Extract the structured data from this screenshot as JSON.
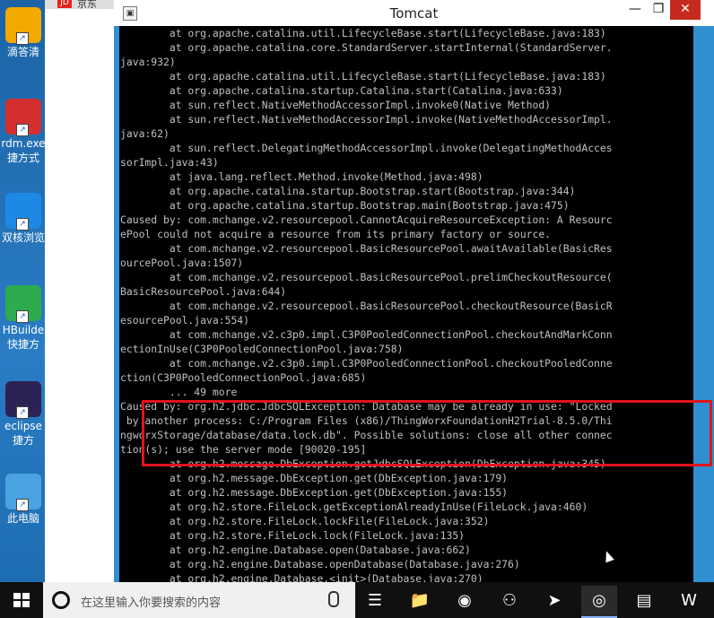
{
  "window": {
    "title": "Tomcat",
    "app_icon_glyph": "▣",
    "minimize": "—",
    "maximize": "❐",
    "close": "✕"
  },
  "browser": {
    "tab_logo": "JD",
    "tab_text": "京东"
  },
  "desktop_icons": [
    {
      "label": "滴答清",
      "icon": "didaqing-icon",
      "color": "#f2a900"
    },
    {
      "label": "rdm.exe\n捷方式",
      "icon": "redis-desktop-icon",
      "color": "#d32f2f"
    },
    {
      "label": "双核浏览",
      "icon": "browser-icon",
      "color": "#1e88e5"
    },
    {
      "label": "HBuilde\n快捷方",
      "icon": "hbuilder-icon",
      "color": "#2eaa4f"
    },
    {
      "label": "eclipse\n捷方",
      "icon": "eclipse-icon",
      "color": "#2c2255"
    },
    {
      "label": "此电脑",
      "icon": "this-pc-icon",
      "color": "#4aa3e0"
    }
  ],
  "console_lines": [
    "        at org.apache.catalina.util.LifecycleBase.start(LifecycleBase.java:183)",
    "        at org.apache.catalina.core.StandardServer.startInternal(StandardServer.",
    "java:932)",
    "        at org.apache.catalina.util.LifecycleBase.start(LifecycleBase.java:183)",
    "        at org.apache.catalina.startup.Catalina.start(Catalina.java:633)",
    "        at sun.reflect.NativeMethodAccessorImpl.invoke0(Native Method)",
    "        at sun.reflect.NativeMethodAccessorImpl.invoke(NativeMethodAccessorImpl.",
    "java:62)",
    "        at sun.reflect.DelegatingMethodAccessorImpl.invoke(DelegatingMethodAcces",
    "sorImpl.java:43)",
    "        at java.lang.reflect.Method.invoke(Method.java:498)",
    "        at org.apache.catalina.startup.Bootstrap.start(Bootstrap.java:344)",
    "        at org.apache.catalina.startup.Bootstrap.main(Bootstrap.java:475)",
    "Caused by: com.mchange.v2.resourcepool.CannotAcquireResourceException: A Resourc",
    "ePool could not acquire a resource from its primary factory or source.",
    "        at com.mchange.v2.resourcepool.BasicResourcePool.awaitAvailable(BasicRes",
    "ourcePool.java:1507)",
    "        at com.mchange.v2.resourcepool.BasicResourcePool.prelimCheckoutResource(",
    "BasicResourcePool.java:644)",
    "        at com.mchange.v2.resourcepool.BasicResourcePool.checkoutResource(BasicR",
    "esourcePool.java:554)",
    "        at com.mchange.v2.c3p0.impl.C3P0PooledConnectionPool.checkoutAndMarkConn",
    "ectionInUse(C3P0PooledConnectionPool.java:758)",
    "        at com.mchange.v2.c3p0.impl.C3P0PooledConnectionPool.checkoutPooledConne",
    "ction(C3P0PooledConnectionPool.java:685)",
    "        ... 49 more",
    "Caused by: org.h2.jdbc.JdbcSQLException: Database may be already in use: \"Locked",
    " by another process: C:/Program Files (x86)/ThingWorxFoundationH2Trial-8.5.0/Thi",
    "ngworxStorage/database/data.lock.db\". Possible solutions: close all other connec",
    "tion(s); use the server mode [90020-195]",
    "        at org.h2.message.DbException.getJdbcSQLException(DbException.java:345)",
    "        at org.h2.message.DbException.get(DbException.java:179)",
    "        at org.h2.message.DbException.get(DbException.java:155)",
    "        at org.h2.store.FileLock.getExceptionAlreadyInUse(FileLock.java:460)",
    "        at org.h2.store.FileLock.lockFile(FileLock.java:352)",
    "        at org.h2.store.FileLock.lock(FileLock.java:135)",
    "        at org.h2.engine.Database.open(Database.java:662)",
    "        at org.h2.engine.Database.openDatabase(Database.java:276)",
    "        at org.h2.engine.Database.<init>(Database.java:270)"
  ],
  "taskbar": {
    "search_placeholder": "在这里输入你要搜索的内容",
    "items": [
      {
        "name": "task-view-icon",
        "glyph": "☰",
        "active": false
      },
      {
        "name": "file-explorer-icon",
        "glyph": "📁",
        "active": false
      },
      {
        "name": "firefox-icon",
        "glyph": "◉",
        "active": false
      },
      {
        "name": "wechat-icon",
        "glyph": "⚇",
        "active": false
      },
      {
        "name": "feishu-icon",
        "glyph": "➤",
        "active": false
      },
      {
        "name": "chrome-icon",
        "glyph": "◎",
        "active": true
      },
      {
        "name": "remote-desktop-icon",
        "glyph": "▤",
        "active": false
      },
      {
        "name": "wps-icon",
        "glyph": "W",
        "active": false
      }
    ]
  },
  "colors": {
    "highlight": "#e2131c",
    "console_bg": "#000000",
    "console_fg": "#c0c0c0",
    "window_frame": "#2f8fd0"
  }
}
